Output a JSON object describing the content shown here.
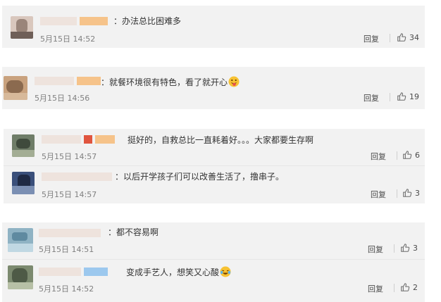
{
  "reply_label": "回复",
  "comments": [
    {
      "text": "：办法总比困难多",
      "time": "5月15日 14:52",
      "likes": "34"
    },
    {
      "text": "：就餐环境很有特色，看了就开心",
      "time": "5月15日 14:56",
      "likes": "19"
    },
    {
      "text": "挺好的，自救总比一直耗着好。。。大家都要生存啊",
      "time": "5月15日 14:57",
      "likes": "6"
    },
    {
      "text": "：以后开学孩子们可以改善生活了，撸串子。",
      "time": "5月15日 14:57",
      "likes": "3"
    },
    {
      "text": "：都不容易啊",
      "time": "5月15日 14:51",
      "likes": "3"
    },
    {
      "text": "变成手艺人，想笑又心酸",
      "time": "5月15日 14:52",
      "likes": "2"
    }
  ],
  "colors": {
    "card_bg": "#f2f2f2",
    "name_blur": "#e8dcd6",
    "badge_orange": "#f5b26b",
    "badge_blue": "#9cc8ee",
    "badge_red": "#e0553f"
  }
}
